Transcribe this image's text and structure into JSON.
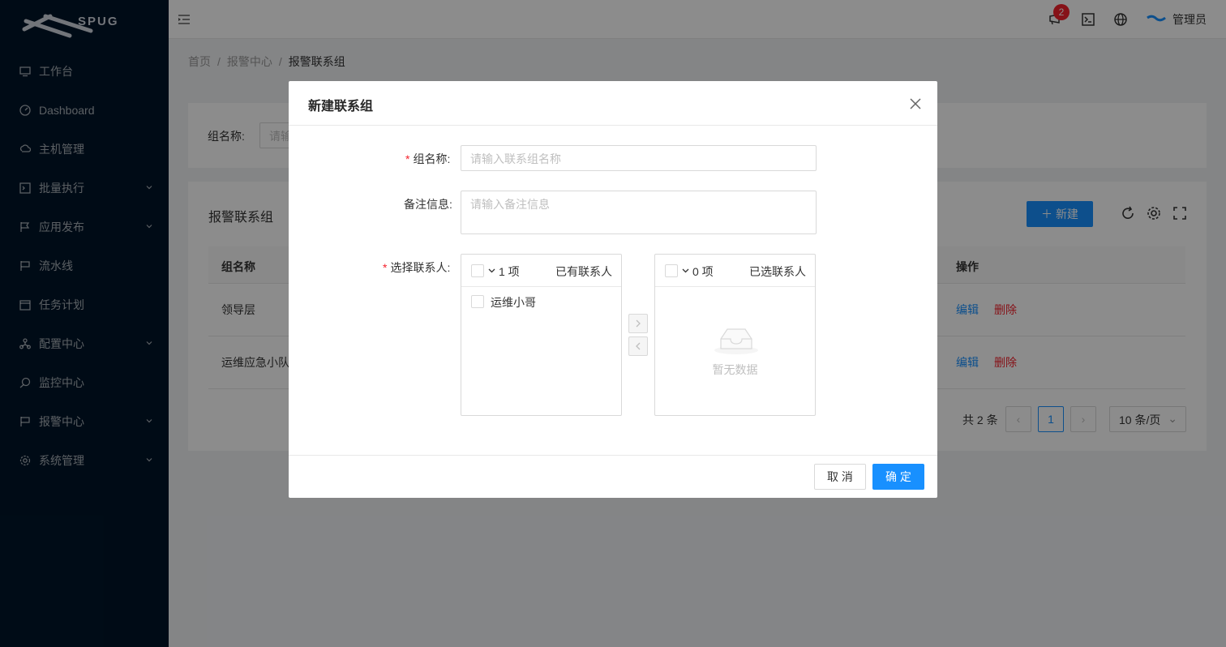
{
  "app": {
    "logo_text": "SPUG"
  },
  "sidebar": {
    "items": [
      {
        "label": "工作台",
        "icon": "desktop-icon",
        "has_arrow": false
      },
      {
        "label": "Dashboard",
        "icon": "dashboard-icon",
        "has_arrow": false
      },
      {
        "label": "主机管理",
        "icon": "cloud-server-icon",
        "has_arrow": false
      },
      {
        "label": "批量执行",
        "icon": "code-icon",
        "has_arrow": true
      },
      {
        "label": "应用发布",
        "icon": "flag-icon",
        "has_arrow": true
      },
      {
        "label": "流水线",
        "icon": "pipeline-icon",
        "has_arrow": false
      },
      {
        "label": "任务计划",
        "icon": "schedule-icon",
        "has_arrow": false
      },
      {
        "label": "配置中心",
        "icon": "deployment-icon",
        "has_arrow": true
      },
      {
        "label": "监控中心",
        "icon": "monitor-icon",
        "has_arrow": false
      },
      {
        "label": "报警中心",
        "icon": "alert-icon",
        "has_arrow": true
      },
      {
        "label": "系统管理",
        "icon": "setting-icon",
        "has_arrow": true
      }
    ]
  },
  "header": {
    "notification_count": "2",
    "admin_name": "管理员"
  },
  "breadcrumb": [
    "首页",
    "报警中心",
    "报警联系组"
  ],
  "search": {
    "label": "组名称:",
    "placeholder": "请输入"
  },
  "list": {
    "title": "报警联系组",
    "new_label": "新建",
    "columns": [
      "组名称",
      "操作"
    ],
    "rows": [
      {
        "name": "领导层",
        "edit": "编辑",
        "delete": "删除"
      },
      {
        "name": "运维应急小队",
        "edit": "编辑",
        "delete": "删除"
      }
    ],
    "pagination": {
      "total": "共 2 条",
      "current": "1",
      "page_size": "10 条/页"
    }
  },
  "modal": {
    "title": "新建联系组",
    "fields": {
      "name_label": "组名称:",
      "name_placeholder": "请输入联系组名称",
      "desc_label": "备注信息:",
      "desc_placeholder": "请输入备注信息",
      "contacts_label": "选择联系人:"
    },
    "transfer": {
      "left": {
        "count": "1 项",
        "title": "已有联系人",
        "items": [
          "运维小哥"
        ]
      },
      "right": {
        "count": "0 项",
        "title": "已选联系人",
        "empty": "暂无数据"
      }
    },
    "cancel_label": "取 消",
    "ok_label": "确 定"
  },
  "colors": {
    "primary": "#1890ff",
    "sider": "#001529",
    "danger": "#f5222d"
  }
}
